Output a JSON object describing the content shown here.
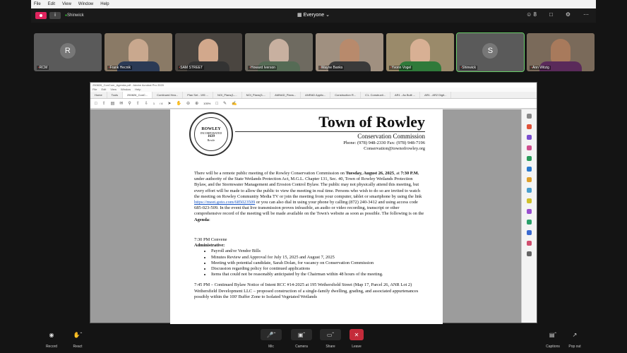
{
  "menu": [
    "File",
    "Edit",
    "View",
    "Window",
    "Help"
  ],
  "topbar": {
    "meeting": "Shinwick",
    "audience": "Everyone",
    "participants": "8"
  },
  "tiles": [
    {
      "name": "RCM",
      "initial": "R",
      "type": "initial"
    },
    {
      "name": "Frank Hecnik",
      "type": "video"
    },
    {
      "name": "SAM STREET",
      "type": "video"
    },
    {
      "name": "Howard Iverson",
      "type": "video"
    },
    {
      "name": "Wayne Banks",
      "type": "video"
    },
    {
      "name": "Yvonn Vogel",
      "type": "video"
    },
    {
      "name": "Shinwick",
      "initial": "S",
      "type": "initial",
      "active": true
    },
    {
      "name": "Ann Witzig",
      "type": "video"
    }
  ],
  "acrobat": {
    "title": "250826_ConCom_Agenda.pdf - Adobe Acrobat Pro 2020",
    "menu": [
      "File",
      "Edit",
      "View",
      "Window",
      "Help"
    ],
    "tabs": [
      "Home",
      "Tools",
      "250826_ConC...",
      "Continued Hea...",
      "Plan Set - 195 ...",
      "NOI_Plans(1-...",
      "NOI_Plans(3-...",
      "AMNAD_Plans...",
      "ANRAD Applic...",
      "Construction R...",
      "C1- Constructi...",
      "AR1 - As Built ...",
      "AR1 - AR2 Digit..."
    ],
    "page": "1",
    "pages": "/ 4",
    "zoom": "105%"
  },
  "doc": {
    "seal": {
      "top": "ROWLEY",
      "mid": "INCORPORATED",
      "year": "1639",
      "place": "Rowle"
    },
    "title": "Town of Rowley",
    "subtitle": "Conservation Commission",
    "phone": "Phone: (978) 948-2330 Fax: (978) 948-7196",
    "email": "Conservation@townofrowley.org",
    "intro_a": "There will be a remote public meeting of the Rowley Conservation Commission on ",
    "intro_date": "Tuesday, August 26, 2025",
    "intro_b": ", at ",
    "intro_time": "7:30 P.M.",
    "intro_c": " under authority of the State Wetlands Protection Act, M.G.L. Chapter 131, Sec. 40, Town of Rowley Wetlands Protection Bylaw, and the Stormwater Management and Erosion Control Bylaw. The public may not physically attend this meeting, but every effort will be made to allow the public to view the meeting in real time. Persons who wish to do so are invited to watch the meeting on Rowley Community Media TV or join the meeting from your computer, tablet or smartphone by using the link ",
    "link": "https://meet.goto.com/685023509",
    "intro_d": " or you can also dial in using your phone by calling (872) 240-3412 and using access code 685-023-509. In the event that live transmission proves infeasible, an audio or video recording, transcript or other comprehensive record of the meeting will be made available on the Town's website as soon as possible. The following is on the ",
    "intro_agenda": "Agenda",
    "convene": "7:30 PM    Convene",
    "admin": "Administrative:",
    "items": [
      "Payroll and/or Vendor Bills",
      "Minutes Review and Approval for July 15, 2025 and August 7, 2025",
      "Meeting with potential candidate, Sarah Dolan, for vacancy on Conservation Commission",
      "Discussion regarding policy for continued applications",
      "Items that could not be reasonably anticipated by the Chairman within 48 hours of the meeting."
    ],
    "cont": "7:45 PM – Continued Bylaw Notice of Intent RCC #14-2025 at 195 Wethersfield Street (Map 17, Parcel 26, ANR Lot 2) Wethersfield Development LLC – proposed construction of a single-family dwelling, grading, and associated appurtenances possibly within the 100' Buffer Zone to Isolated Vegetated Wetlands"
  },
  "controls": {
    "record": "Record",
    "react": "React",
    "mic": "Mic",
    "camera": "Camera",
    "share": "Share",
    "leave": "Leave",
    "captions": "Captions",
    "popout": "Pop out"
  }
}
